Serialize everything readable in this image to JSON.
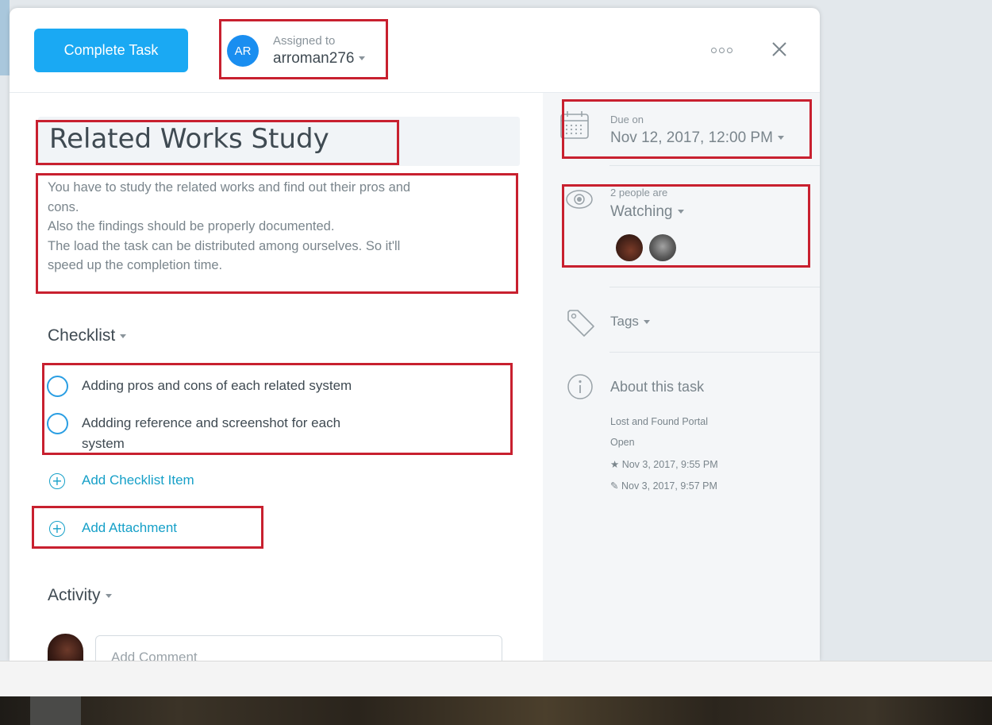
{
  "header": {
    "complete_button": "Complete Task",
    "assignee_initials": "AR",
    "assigned_label": "Assigned to",
    "assignee_name": "arroman276"
  },
  "task": {
    "title": "Related Works Study",
    "description": [
      "You have to study the related works and find out their pros and",
      "cons.",
      "Also the findings should be properly documented.",
      "The load the task can be distributed among ourselves. So it'll",
      "speed up the completion time."
    ]
  },
  "checklist": {
    "heading": "Checklist",
    "items": [
      {
        "label": "Adding pros and cons of each related system"
      },
      {
        "label": "Addding reference and screenshot for each",
        "label_cont": "system"
      }
    ],
    "add_item": "Add Checklist Item"
  },
  "attachment": {
    "add_label": "Add Attachment"
  },
  "activity": {
    "heading": "Activity",
    "comment_placeholder": "Add Comment"
  },
  "sidebar": {
    "due_label": "Due on",
    "due_value": "Nov 12, 2017, 12:00 PM",
    "watch_label": "2 people are",
    "watch_value": "Watching",
    "tags_label": "Tags",
    "about_heading": "About this task",
    "project": "Lost and Found Portal",
    "status": "Open",
    "created": "Nov 3, 2017, 9:55 PM",
    "edited": "Nov 3, 2017, 9:57 PM"
  },
  "colors": {
    "primary_button": "#1aa9f3",
    "avatar_blue": "#1a8ef0",
    "link_teal": "#16a0c8",
    "annotation_red": "#c8202f"
  },
  "icons": [
    "more-options-icon",
    "close-icon",
    "calendar-icon",
    "eye-icon",
    "tag-icon",
    "info-icon",
    "plus-circle-icon",
    "star-icon",
    "pencil-icon",
    "caret-down-icon"
  ]
}
